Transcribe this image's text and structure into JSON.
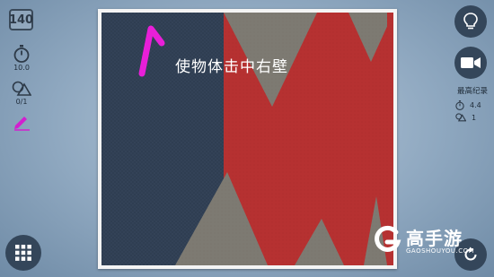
{
  "hud": {
    "level": "140",
    "timer_value": "10.0",
    "shapes_value": "0/1"
  },
  "best_record": {
    "title": "最高纪录",
    "time": "4.4",
    "shapes": "1"
  },
  "goal": {
    "text": "使物体击中右壁"
  },
  "watermark": {
    "name": "高手游",
    "url": "GAOSHOUYOU.COM"
  },
  "colors": {
    "wall_red": "#b63131",
    "wall_gray": "#7d7a72",
    "dark_panel": "#2f3e52",
    "pen_magenta": "#e81fd8",
    "button_bg": "#34465a"
  },
  "icons": {
    "timer": "stopwatch-icon",
    "shapes": "shapes-icon",
    "pen": "pen-icon",
    "menu": "grid-menu-icon",
    "hint": "lightbulb-icon",
    "video": "video-camera-icon",
    "restart": "restart-icon"
  }
}
